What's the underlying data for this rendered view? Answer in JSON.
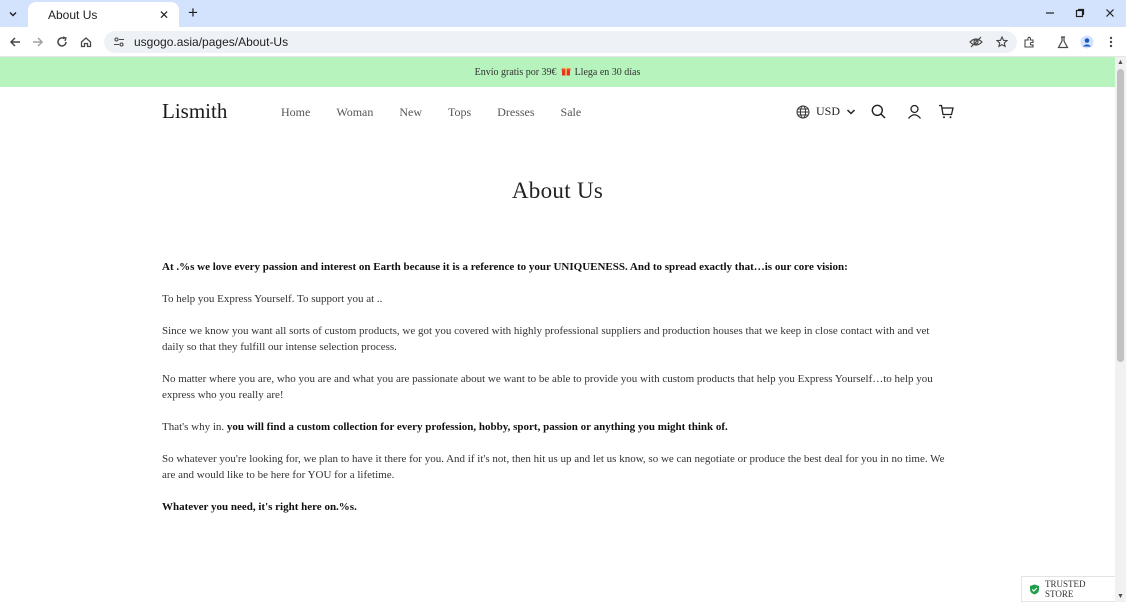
{
  "browser": {
    "tab_title": "About Us",
    "url": "usgogo.asia/pages/About-Us"
  },
  "announcement": {
    "text_before": "Envío gratis por 39€",
    "gift_icon": "gift-icon",
    "text_after": "Llega en 30 días",
    "bg_color": "#b6f3bd"
  },
  "header": {
    "logo": "Lismith",
    "nav": [
      "Home",
      "Woman",
      "New",
      "Tops",
      "Dresses",
      "Sale"
    ],
    "currency": "USD"
  },
  "page": {
    "title": "About Us",
    "paragraphs": {
      "p1": "At .%s we love every passion and interest on Earth because it is a reference to your UNIQUENESS. And to spread exactly that…is our core vision:",
      "p2": "To help you Express Yourself. To support you at ..",
      "p3": "Since we know you want all sorts of custom products, we got you covered with highly professional suppliers and production houses that we keep in close contact with and vet daily so that they fulfill our intense selection process.",
      "p4": "No matter where you are, who you are and what you are passionate about we want to be able to provide you with custom products that help you Express Yourself…to help you express who you really are!",
      "p5_plain": "That's why in. ",
      "p5_bold": "you will find a custom collection for every profession, hobby, sport, passion or anything you might think of.",
      "p6": "So whatever you're looking for, we plan to have it there for you. And if it's not, then hit us up and let us know, so we can negotiate or produce the best deal for you in no time. We are and would like to be here for YOU for a lifetime.",
      "p7": "Whatever you need, it's right here on.%s."
    }
  },
  "trust_badge": {
    "label": "TRUSTED STORE",
    "color": "#1e9e4a"
  }
}
